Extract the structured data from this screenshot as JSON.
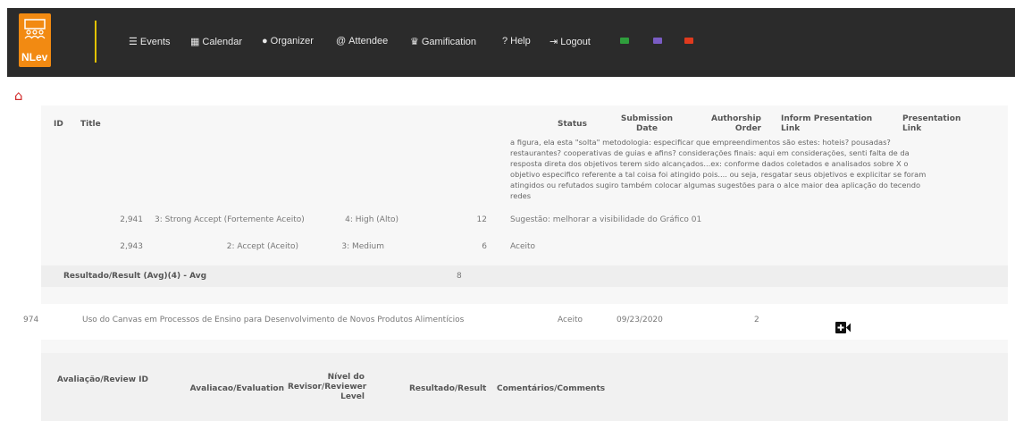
{
  "app": {
    "logo_text": "NLev"
  },
  "nav": {
    "items": [
      {
        "icon": "list-icon",
        "glyph": "☰",
        "label": "Events"
      },
      {
        "icon": "calendar-icon",
        "glyph": "▦",
        "label": "Calendar"
      },
      {
        "icon": "user-circle-icon",
        "glyph": "●",
        "label": "Organizer"
      },
      {
        "icon": "at-icon",
        "glyph": "@",
        "label": "Attendee"
      },
      {
        "icon": "trophy-icon",
        "glyph": "♛",
        "label": "Gamification"
      },
      {
        "icon": "question-icon",
        "glyph": "?",
        "label": "Help"
      },
      {
        "icon": "logout-icon",
        "glyph": "⇥",
        "label": "Logout"
      }
    ],
    "flags": [
      {
        "name": "flag-brazil",
        "color": "#2f9e3c"
      },
      {
        "name": "flag-usa",
        "color": "#7a5cc4"
      },
      {
        "name": "flag-spain",
        "color": "#e03a1e"
      }
    ]
  },
  "table": {
    "headers": {
      "id": "ID",
      "title": "Title",
      "status": "Status",
      "submission_date": "Submission Date",
      "authorship_order": "Authorship Order",
      "inform_presentation_link": "Inform Presentation Link",
      "presentation_link": "Presentation Link"
    },
    "comment_text": "a figura, ela esta \"solta\" metodologia: especificar que empreendimentos são estes: hoteis? pousadas? restaurantes? cooperativas de guias e afins? considerações finais: aqui em considerações, senti falta de da resposta direta dos objetivos terem sido alcançados...ex: conforme dados coletados e analisados sobre X o objetivo especifico referente a tal coisa foi atingido pois.... ou seja, resgatar seus objetivos e explicitar se foram atingidos ou refutados sugiro também colocar algumas sugestões para o alce maior dea aplicação do tecendo redes",
    "reviews": [
      {
        "id": "2,941",
        "evaluation": "3: Strong Accept (Fortemente Aceito)",
        "level": "4: High (Alto)",
        "result": "12",
        "comment": "Sugestão: melhorar a visibilidade do Gráfico 01"
      },
      {
        "id": "2,943",
        "evaluation": "2: Accept (Aceito)",
        "level": "3: Medium",
        "result": "6",
        "comment": "Aceito"
      }
    ],
    "average": {
      "label": "Resultado/Result (Avg)(4) - Avg",
      "value": "8"
    },
    "paper": {
      "id": "974",
      "title": "Uso do Canvas em Processos de Ensino para Desenvolvimento de Novos Produtos Alimentícios",
      "status": "Aceito",
      "date": "09/23/2020",
      "order": "2"
    },
    "review_headers": {
      "review_id": "Avaliação/Review ID",
      "evaluation": "Avaliacao/Evaluation",
      "level": "Nível do Revisor/Reviewer Level",
      "result": "Resultado/Result",
      "comments": "Comentários/Comments"
    }
  }
}
